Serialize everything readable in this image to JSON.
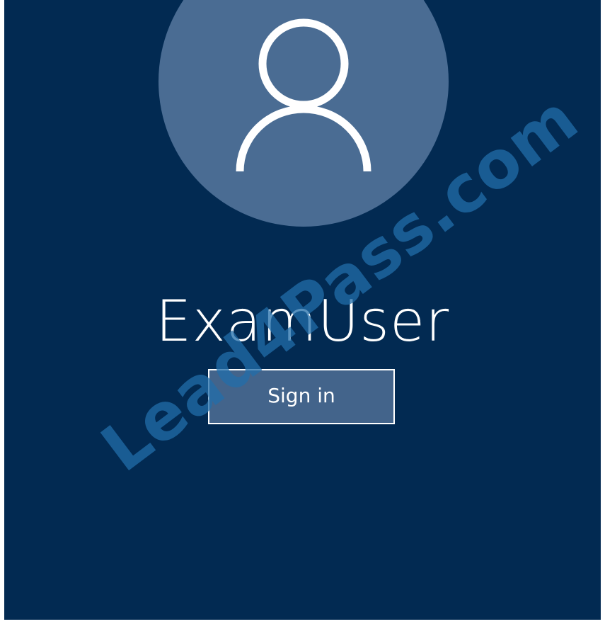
{
  "user": {
    "name": "ExamUser"
  },
  "actions": {
    "sign_in_label": "Sign in"
  },
  "watermark": {
    "text": "Lead4Pass.com"
  },
  "icons": {
    "avatar": "user-silhouette-icon"
  },
  "colors": {
    "background": "#022a52",
    "avatar_circle": "#4a6c93",
    "button_fill": "#43648b",
    "foreground": "#ffffff",
    "watermark": "#216eaa"
  }
}
